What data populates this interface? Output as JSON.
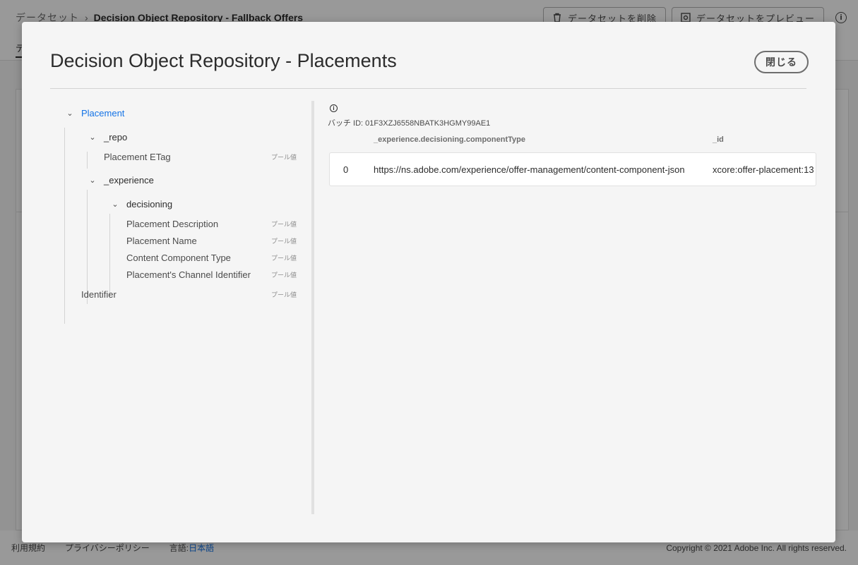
{
  "background": {
    "breadcrumb": {
      "parent": "データセット",
      "current": "Decision Object Repository - Fallback Offers"
    },
    "actions": {
      "delete_label": "データセットを削除",
      "preview_label": "データセットをプレビュー"
    },
    "tab_fragment": "デ",
    "footer": {
      "terms": "利用規約",
      "privacy": "プライバシーポリシー",
      "language_label": "言語:",
      "language_value": "日本語",
      "copyright": "Copyright © 2021 Adobe Inc. All rights reserved."
    }
  },
  "modal": {
    "title": "Decision Object Repository - Placements",
    "close_label": "閉じる",
    "tree": {
      "type_label": "プール値",
      "root": "Placement",
      "repo": "_repo",
      "repo_etag": "Placement ETag",
      "experience": "_experience",
      "decisioning": "decisioning",
      "placement_description": "Placement Description",
      "placement_name": "Placement Name",
      "content_component_type": "Content Component Type",
      "channel_identifier": "Placement's Channel Identifier",
      "identifier": "Identifier"
    },
    "data": {
      "batch_label": "バッチ ID: 01F3XZJ6558NBATK3HGMY99AE1",
      "columns": [
        "_experience.decisioning.componentType",
        "_id"
      ],
      "rows": [
        {
          "index": "0",
          "component_type": "https://ns.adobe.com/experience/offer-management/content-component-json",
          "id": "xcore:offer-placement:13"
        }
      ]
    }
  }
}
